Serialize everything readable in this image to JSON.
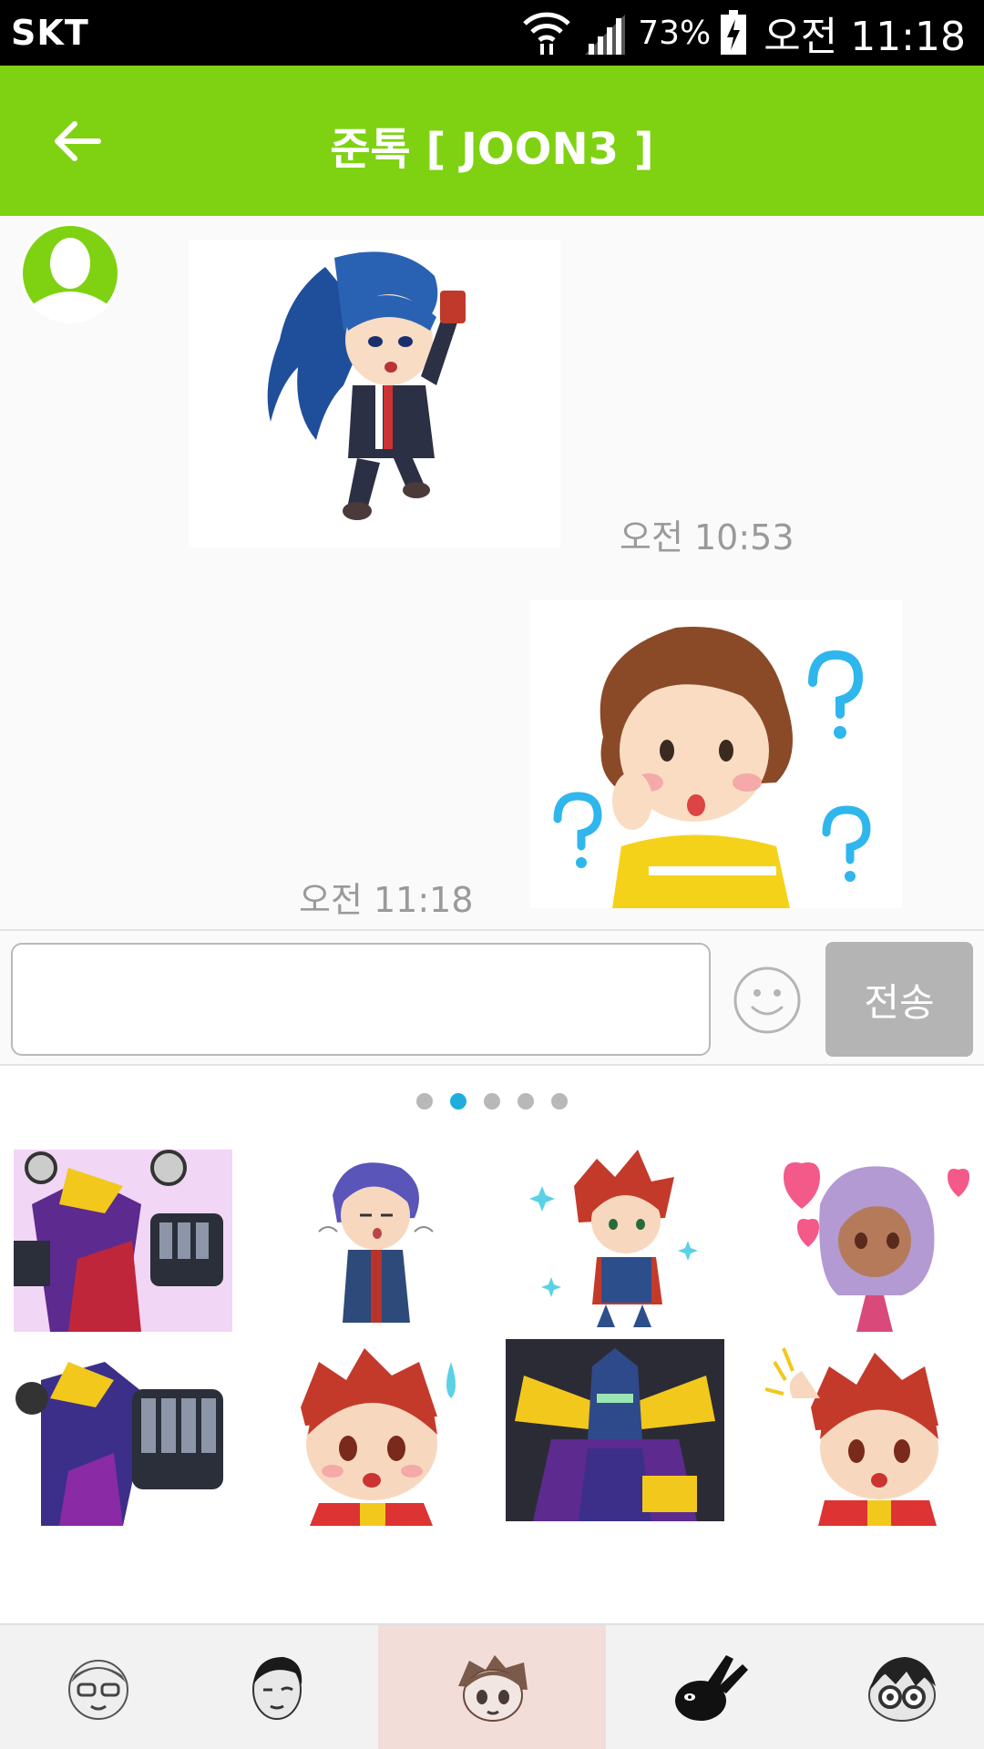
{
  "status_bar": {
    "carrier": "SKT",
    "battery_percent": "73%",
    "time": "오전 11:18",
    "icons": [
      "wifi-icon",
      "signal-icon",
      "battery-charging-icon"
    ]
  },
  "app_bar": {
    "title": "준톡 [ JOON3 ]",
    "back_icon": "arrow-left-icon",
    "background": "#7ed212"
  },
  "messages": [
    {
      "direction": "incoming",
      "type": "sticker",
      "sticker": "blue-haired-boy-holding-card",
      "time": "오전 10:53"
    },
    {
      "direction": "outgoing",
      "type": "sticker",
      "sticker": "confused-girl-with-question-marks",
      "time": "오전 11:18"
    }
  ],
  "composer": {
    "input_value": "",
    "emoji_icon": "smiley-icon",
    "send_label": "전송"
  },
  "sticker_panel": {
    "page_count": 5,
    "active_page": 2,
    "stickers": [
      "purple-robot-sticker",
      "purple-haired-boy-sticker",
      "red-haired-boy-sparkle-sticker",
      "lavender-haired-girl-hearts-sticker",
      "robot-fist-sticker",
      "red-haired-boy-sweat-sticker",
      "robot-head-sticker",
      "red-haired-boy-scratching-head-sticker"
    ]
  },
  "tabs": [
    {
      "icon": "boy-with-glasses-icon",
      "selected": false
    },
    {
      "icon": "man-winking-icon",
      "selected": false
    },
    {
      "icon": "anime-boy-icon",
      "selected": true
    },
    {
      "icon": "black-rabbit-icon",
      "selected": false
    },
    {
      "icon": "nerd-glasses-icon",
      "selected": false
    }
  ],
  "colors": {
    "accent": "#7ed212",
    "active_dot": "#1eaedc",
    "send_button": "#b4b4b4",
    "selected_tab": "#f3ddd8"
  }
}
